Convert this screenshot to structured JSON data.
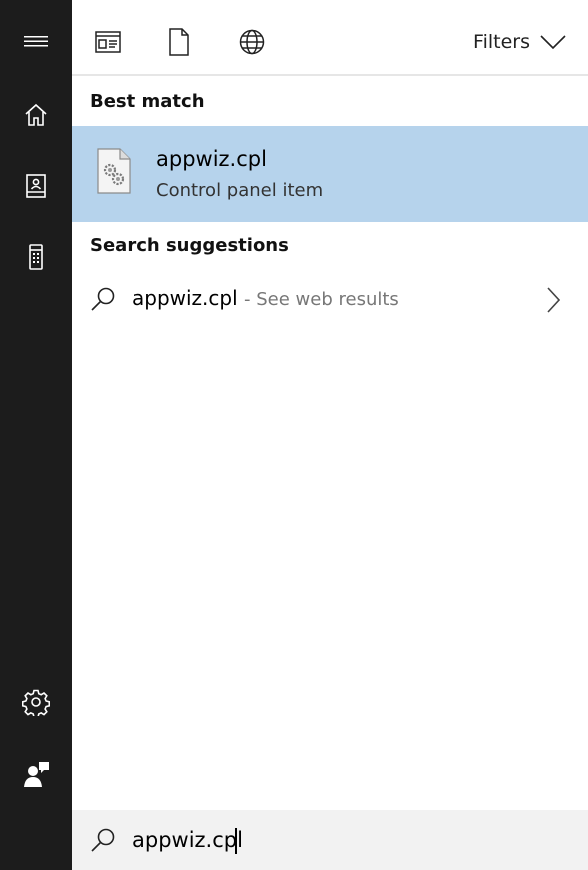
{
  "rail": {
    "items": [
      {
        "icon": "hamburger-menu-icon"
      },
      {
        "icon": "home-icon"
      },
      {
        "icon": "notebook-icon"
      },
      {
        "icon": "phone-device-icon"
      },
      {
        "icon": "settings-gear-icon"
      },
      {
        "icon": "feedback-person-icon"
      }
    ]
  },
  "topbar": {
    "scopes": [
      {
        "icon": "apps-icon"
      },
      {
        "icon": "document-icon"
      },
      {
        "icon": "web-globe-icon"
      }
    ],
    "filters_label": "Filters"
  },
  "best_match": {
    "section_label": "Best match",
    "title": "appwiz.cpl",
    "subtitle": "Control panel item",
    "icon": "control-panel-file-icon"
  },
  "suggestions": {
    "section_label": "Search suggestions",
    "items": [
      {
        "query": "appwiz.cpl",
        "suffix": "- See web results"
      }
    ]
  },
  "search": {
    "value": "appwiz.cpl"
  },
  "colors": {
    "rail_bg": "#1c1c1c",
    "selection_bg": "#b6d3ec",
    "searchbar_bg": "#f2f2f2"
  }
}
